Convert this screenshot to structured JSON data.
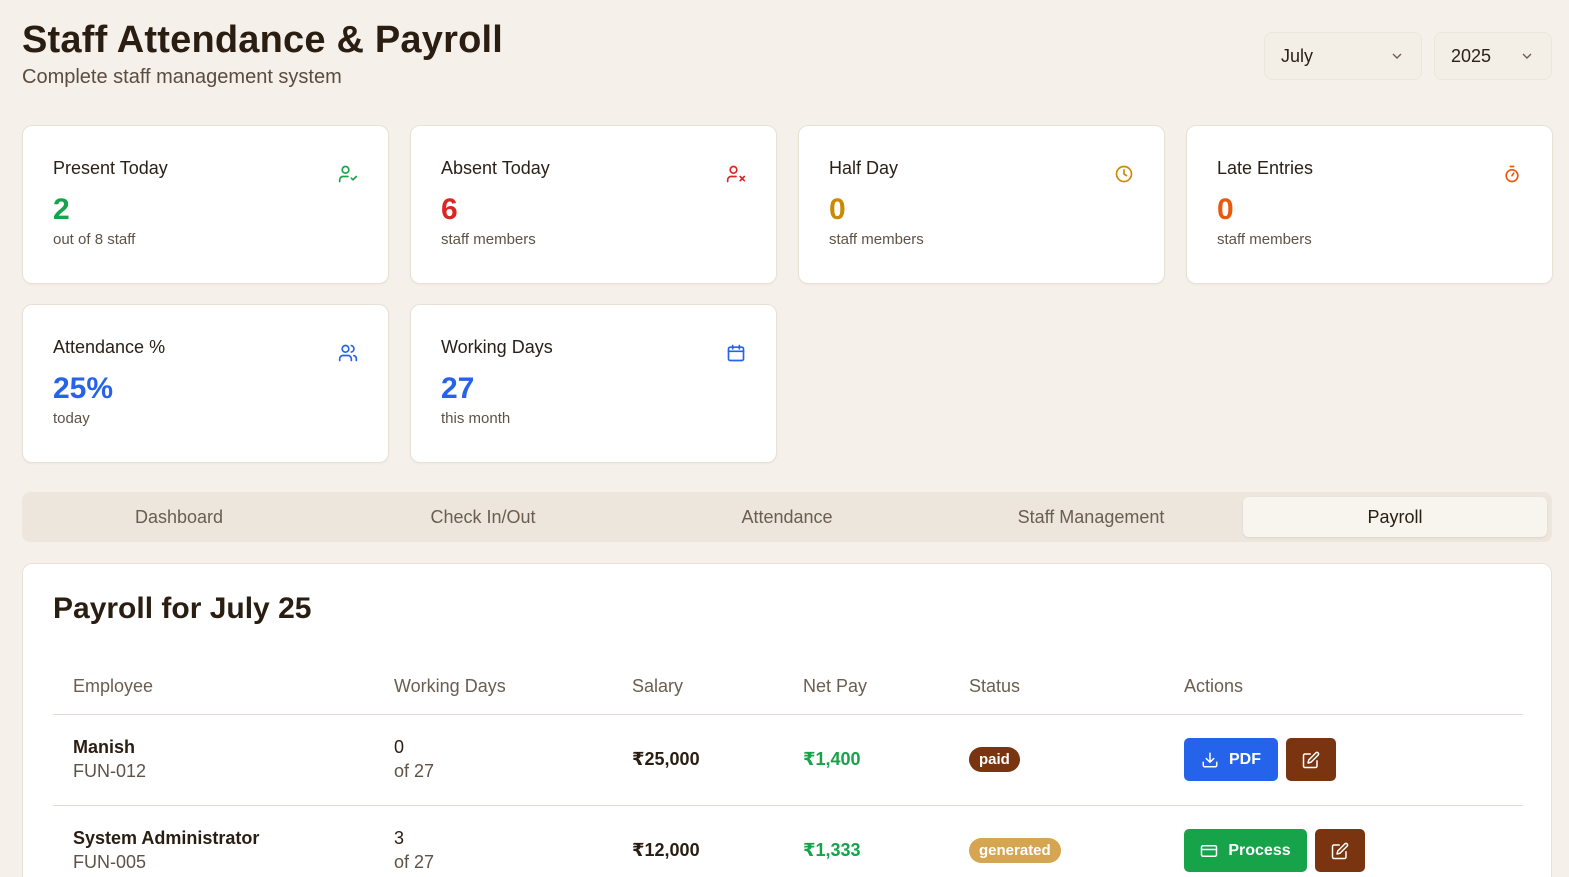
{
  "header": {
    "title": "Staff Attendance & Payroll",
    "subtitle": "Complete staff management system",
    "month": "July",
    "year": "2025"
  },
  "stats": [
    {
      "label": "Present Today",
      "value": "2",
      "caption": "out of 8 staff",
      "icon": "user-check-icon",
      "color": "#16a34a"
    },
    {
      "label": "Absent Today",
      "value": "6",
      "caption": "staff members",
      "icon": "user-x-icon",
      "color": "#dc2626"
    },
    {
      "label": "Half Day",
      "value": "0",
      "caption": "staff members",
      "icon": "clock-icon",
      "color": "#ca8a04"
    },
    {
      "label": "Late Entries",
      "value": "0",
      "caption": "staff members",
      "icon": "timer-icon",
      "color": "#ea580c"
    },
    {
      "label": "Attendance %",
      "value": "25%",
      "caption": "today",
      "icon": "users-icon",
      "color": "#2563eb"
    },
    {
      "label": "Working Days",
      "value": "27",
      "caption": "this month",
      "icon": "calendar-icon",
      "color": "#2563eb"
    }
  ],
  "tabs": [
    "Dashboard",
    "Check In/Out",
    "Attendance",
    "Staff Management",
    "Payroll"
  ],
  "active_tab": "Payroll",
  "payroll": {
    "title": "Payroll for July 25",
    "columns": [
      "Employee",
      "Working Days",
      "Salary",
      "Net Pay",
      "Status",
      "Actions"
    ],
    "rows": [
      {
        "name": "Manish",
        "id": "FUN-012",
        "days": "0",
        "days_of": "of 27",
        "salary": "₹25,000",
        "net_pay": "₹1,400",
        "status": "paid",
        "action": "PDF"
      },
      {
        "name": "System Administrator",
        "id": "FUN-005",
        "days": "3",
        "days_of": "of 27",
        "salary": "₹12,000",
        "net_pay": "₹1,333",
        "status": "generated",
        "action": "Process"
      }
    ]
  }
}
